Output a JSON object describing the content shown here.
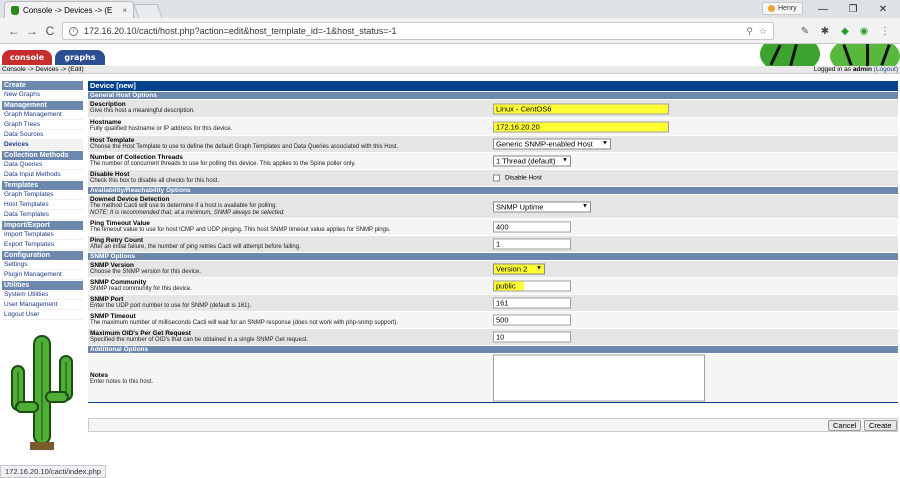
{
  "browser": {
    "tab_title": "Console -> Devices -> (E",
    "tab_close": "×",
    "profile_name": "Henry",
    "url": "172.16.20.10/cacti/host.php?action=edit&host_template_id=-1&host_status=-1",
    "back": "←",
    "forward": "→",
    "reload": "C",
    "minimize": "—",
    "maximize": "❐",
    "close": "✕",
    "status_url": "172.16.20.10/cacti/index.php"
  },
  "header": {
    "console_tab": "console",
    "graphs_tab": "graphs",
    "breadcrumb": "Console -> Devices -> (Edit)",
    "logged_prefix": "Logged in as",
    "user": "admin",
    "logout": "(Logout)"
  },
  "menu": [
    {
      "type": "head",
      "label": "Create"
    },
    {
      "type": "item",
      "label": "New Graphs"
    },
    {
      "type": "head",
      "label": "Management"
    },
    {
      "type": "item",
      "label": "Graph Management"
    },
    {
      "type": "item",
      "label": "Graph Trees"
    },
    {
      "type": "item",
      "label": "Data Sources"
    },
    {
      "type": "item",
      "label": "Devices",
      "selected": true
    },
    {
      "type": "head",
      "label": "Collection Methods"
    },
    {
      "type": "item",
      "label": "Data Queries"
    },
    {
      "type": "item",
      "label": "Data Input Methods"
    },
    {
      "type": "head",
      "label": "Templates"
    },
    {
      "type": "item",
      "label": "Graph Templates"
    },
    {
      "type": "item",
      "label": "Host Templates"
    },
    {
      "type": "item",
      "label": "Data Templates"
    },
    {
      "type": "head",
      "label": "Import/Export"
    },
    {
      "type": "item",
      "label": "Import Templates"
    },
    {
      "type": "item",
      "label": "Export Templates"
    },
    {
      "type": "head",
      "label": "Configuration"
    },
    {
      "type": "item",
      "label": "Settings"
    },
    {
      "type": "item",
      "label": "Plugin Management"
    },
    {
      "type": "head",
      "label": "Utilities"
    },
    {
      "type": "item",
      "label": "System Utilities"
    },
    {
      "type": "item",
      "label": "User Management"
    },
    {
      "type": "item",
      "label": "Logout User"
    }
  ],
  "form": {
    "title": "Device [new]",
    "sections": {
      "general": "General Host Options",
      "availability": "Availability/Reachability Options",
      "snmp": "SNMP Options",
      "additional": "Additional Options"
    },
    "description": {
      "label": "Description",
      "desc": "Give this host a meaningful description.",
      "value": "Linux - CentOS6"
    },
    "hostname": {
      "label": "Hostname",
      "desc": "Fully qualified hostname or IP address for this device.",
      "value": "172.16.20.20"
    },
    "host_template": {
      "label": "Host Template",
      "desc": "Choose the Host Template to use to define the default Graph Templates and Data Queries associated with this Host.",
      "value": "Generic SNMP-enabled Host"
    },
    "threads": {
      "label": "Number of Collection Threads",
      "desc": "The number of concurrent threads to use for polling this device. This applies to the Spine poller only.",
      "value": "1 Thread (default)"
    },
    "disable": {
      "label": "Disable Host",
      "desc": "Check this box to disable all checks for this host.",
      "check_label": "Disable Host"
    },
    "downed": {
      "label": "Downed Device Detection",
      "desc": "The method Cacti will use to determine if a host is available for polling.",
      "note": "NOTE: It is recommended that, at a minimum, SNMP always be selected.",
      "value": "SNMP Uptime"
    },
    "ping_timeout": {
      "label": "Ping Timeout Value",
      "desc": "The timeout value to use for host ICMP and UDP pinging. This host SNMP timeout value applies for SNMP pings.",
      "value": "400"
    },
    "ping_retry": {
      "label": "Ping Retry Count",
      "desc": "After an initial failure, the number of ping retries Cacti will attempt before failing.",
      "value": "1"
    },
    "snmp_version": {
      "label": "SNMP Version",
      "desc": "Choose the SNMP version for this device.",
      "value": "Version 2"
    },
    "snmp_community": {
      "label": "SNMP Community",
      "desc": "SNMP read community for this device.",
      "value": "public"
    },
    "snmp_port": {
      "label": "SNMP Port",
      "desc": "Enter the UDP port number to use for SNMP (default is 161).",
      "value": "161"
    },
    "snmp_timeout": {
      "label": "SNMP Timeout",
      "desc": "The maximum number of milliseconds Cacti will wait for an SNMP response (does not work with php-snmp support).",
      "value": "500"
    },
    "max_oids": {
      "label": "Maximum OID's Per Get Request",
      "desc": "Specified the number of OID's that can be obtained in a single SNMP Get request.",
      "value": "10"
    },
    "notes": {
      "label": "Notes",
      "desc": "Enter notes to this host."
    }
  },
  "actions": {
    "cancel": "Cancel",
    "create": "Create"
  }
}
